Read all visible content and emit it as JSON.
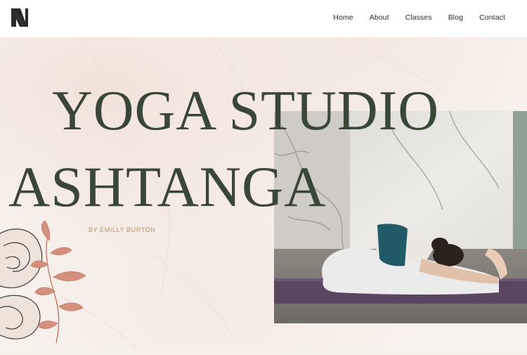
{
  "brand": {
    "logo_letter": "N"
  },
  "nav": {
    "items": [
      {
        "label": "Home"
      },
      {
        "label": "About"
      },
      {
        "label": "Classes"
      },
      {
        "label": "Blog"
      },
      {
        "label": "Contact"
      }
    ]
  },
  "hero": {
    "title_line_1": "YOGA STUDIO",
    "title_line_2": "ASHTANGA",
    "byline": "BY EMILLY BURTON"
  },
  "colors": {
    "title": "#3a4636",
    "byline": "#b8976b",
    "background": "#f8f2ee",
    "leaf": "#d4907c",
    "mat": "#5a4660",
    "top": "#1f5a66"
  },
  "icons": [
    "brand-logo-icon",
    "yoga-photo",
    "line-art-face",
    "leaf-branch"
  ]
}
